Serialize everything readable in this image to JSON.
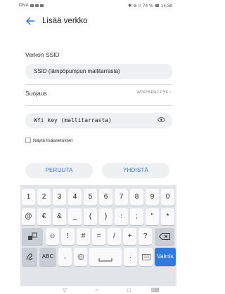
{
  "status_bar": {
    "left_text": "DNA",
    "battery": "74 %",
    "time": "14.38"
  },
  "header": {
    "title": "Lisää verkko"
  },
  "ssid": {
    "label": "Verkon SSID",
    "value": "SSID (lämpöpumpun mallitarrasta)"
  },
  "security": {
    "label": "Suojaus",
    "value": "WPA/WPA2 PSK"
  },
  "password": {
    "value": "Wfi key (mallitarrasta)"
  },
  "advanced": {
    "label": "Näytä lisäasetukset"
  },
  "buttons": {
    "cancel": "PERUUTA",
    "connect": "YHDISTÄ"
  },
  "keyboard": {
    "row1": [
      "1",
      "2",
      "3",
      "4",
      "5",
      "6",
      "7",
      "8",
      "9",
      "0"
    ],
    "row2": [
      "@",
      "€",
      "&",
      "_",
      "(",
      ")",
      ":",
      ";",
      "\"",
      "*"
    ],
    "row3": [
      "☺",
      "!",
      "#",
      "=",
      "/",
      "+",
      "?"
    ],
    "abc_label": "ABC",
    "comma": ",",
    "period": ".",
    "enter_label": "Valmis"
  }
}
